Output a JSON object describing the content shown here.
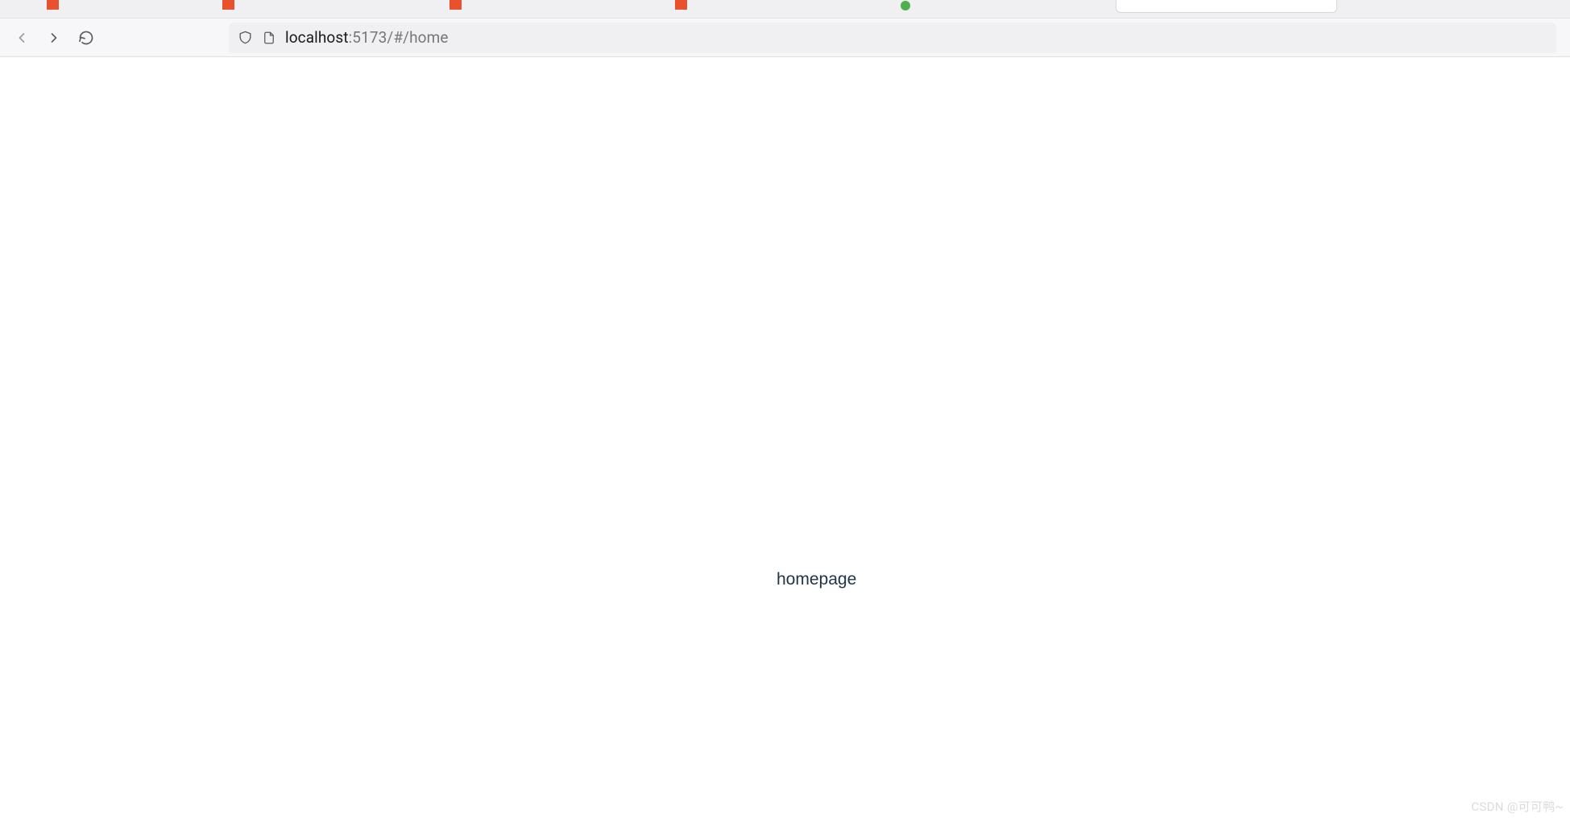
{
  "url": {
    "host": "localhost",
    "rest": ":5173/#/home"
  },
  "page": {
    "content_text": "homepage"
  },
  "watermark": "CSDN @可可鸭~"
}
